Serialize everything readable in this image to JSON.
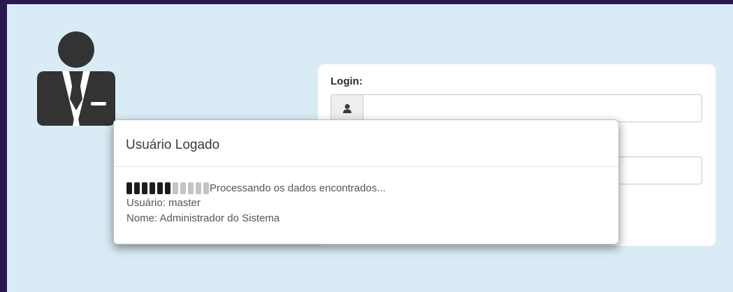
{
  "login": {
    "label": "Login:",
    "username_placeholder": "",
    "password_placeholder": ""
  },
  "modal": {
    "title": "Usuário Logado",
    "progress": {
      "active": 6,
      "total": 11
    },
    "status": "Processando os dados encontrados...",
    "user_line": "Usuário: master",
    "name_line": "Nome: Administrador do Sistema"
  },
  "colors": {
    "background_frame": "#2a1850",
    "panel": "#d9ecf6",
    "avatar": "#333333"
  }
}
